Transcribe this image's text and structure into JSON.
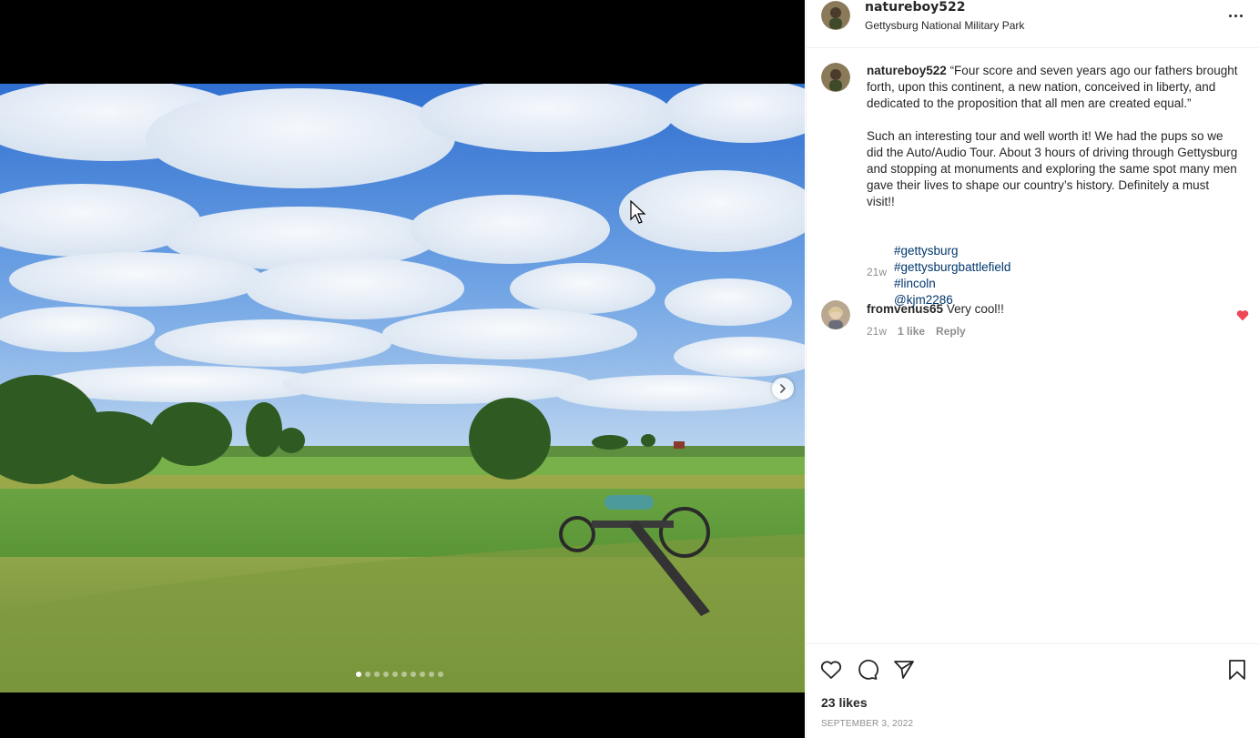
{
  "post": {
    "username": "natureboy522",
    "location": "Gettysburg National Military Park",
    "caption_quote": "“Four score and seven years ago our fathers brought forth, upon this continent, a new nation, conceived in liberty, and dedicated to the proposition that all men are created equal.”",
    "caption_body": "Such an interesting tour and well worth it! We had the pups so we did the Auto/Audio Tour. About 3 hours of driving through Gettysburg and stopping at monuments and exploring the same spot many men gave their lives to shape our country’s history. Definitely a must visit!!",
    "tags": [
      "#gettysburg",
      "#gettysburgbattlefield",
      "#lincoln",
      "@kjm2286"
    ],
    "caption_time": "21w",
    "likes": "23 likes",
    "date": "SEPTEMBER 3, 2022"
  },
  "comment": {
    "username": "fromvenus65",
    "text": "Very cool!!",
    "time": "21w",
    "likes": "1 like",
    "reply": "Reply"
  },
  "carousel": {
    "total_slides": 10,
    "current_slide": 1
  },
  "colors": {
    "link": "#00376b",
    "heart_red": "#ed4956",
    "muted": "#8e8e8e"
  },
  "icons": {
    "more": "more-horizontal-icon",
    "like": "heart-icon",
    "comment": "comment-bubble-icon",
    "share": "paper-plane-icon",
    "save": "bookmark-icon",
    "next": "chevron-right-icon"
  }
}
